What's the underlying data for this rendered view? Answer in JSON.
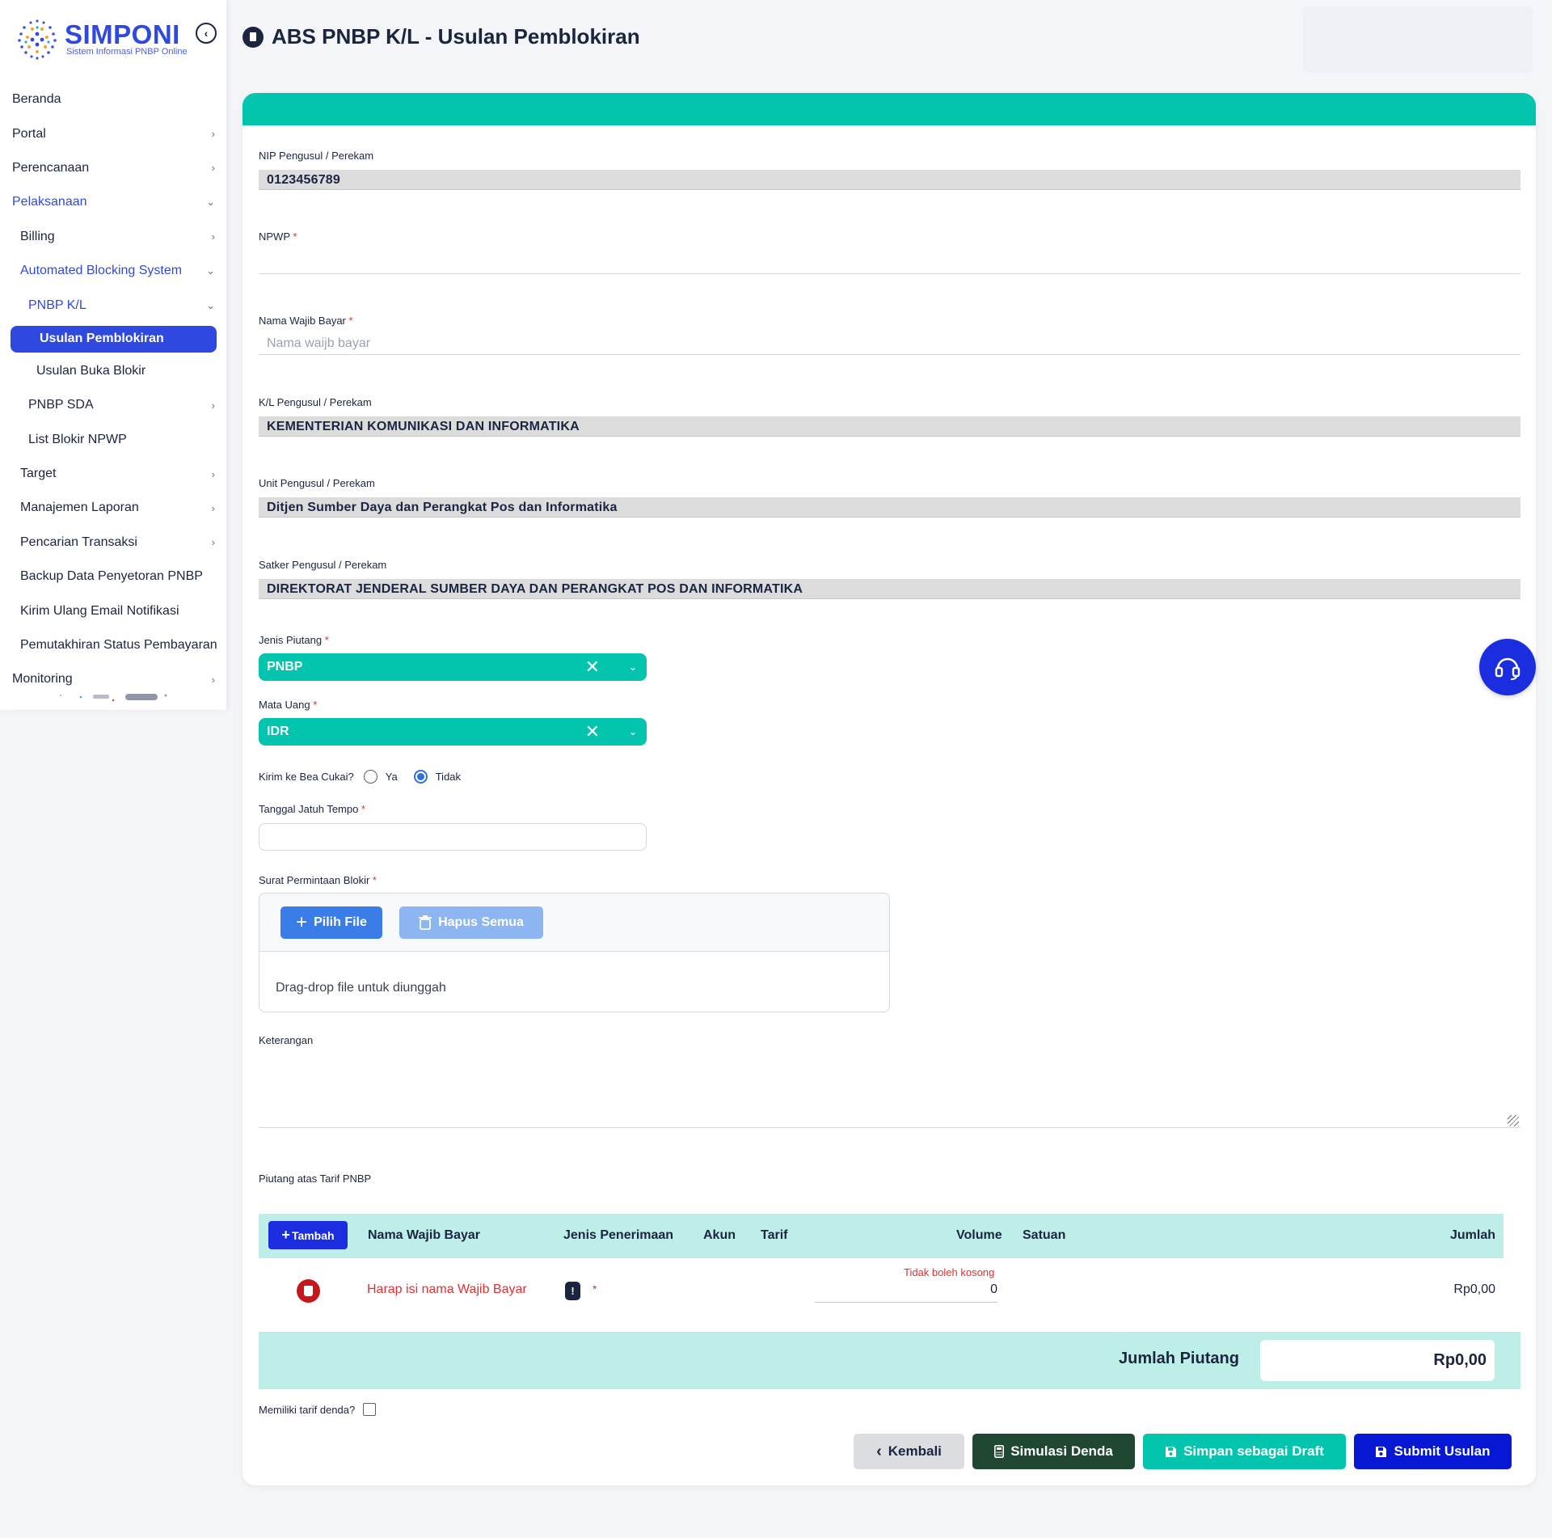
{
  "brand": {
    "name": "SIMPONI",
    "tagline": "Sistem Informasi PNBP Online"
  },
  "sidebar": {
    "items": [
      {
        "label": "Beranda",
        "level": 0
      },
      {
        "label": "Portal",
        "level": 0,
        "chevron": "right"
      },
      {
        "label": "Perencanaan",
        "level": 0,
        "chevron": "right"
      },
      {
        "label": "Pelaksanaan",
        "level": 0,
        "chevron": "down",
        "active": true
      },
      {
        "label": "Billing",
        "level": 1,
        "chevron": "right"
      },
      {
        "label": "Automated Blocking System",
        "level": 1,
        "chevron": "down",
        "active": true
      },
      {
        "label": "PNBP K/L",
        "level": 2,
        "chevron": "down",
        "active": true
      },
      {
        "label": "Usulan Pemblokiran",
        "level": 3,
        "selected": true
      },
      {
        "label": "Usulan Buka Blokir",
        "level": 3
      },
      {
        "label": "PNBP SDA",
        "level": 2,
        "chevron": "right"
      },
      {
        "label": "List Blokir NPWP",
        "level": 2
      },
      {
        "label": "Target",
        "level": 1,
        "chevron": "right"
      },
      {
        "label": "Manajemen Laporan",
        "level": 1,
        "chevron": "right"
      },
      {
        "label": "Pencarian Transaksi",
        "level": 1,
        "chevron": "right"
      },
      {
        "label": "Backup Data Penyetoran PNBP",
        "level": 1
      },
      {
        "label": "Kirim Ulang Email Notifikasi",
        "level": 1
      },
      {
        "label": "Pemutakhiran Status Pembayaran",
        "level": 1
      },
      {
        "label": "Monitoring",
        "level": 0,
        "chevron": "right"
      }
    ]
  },
  "header": {
    "title": "ABS PNBP K/L - Usulan Pemblokiran"
  },
  "form": {
    "nip": {
      "label": "NIP Pengusul / Perekam",
      "value": "0123456789"
    },
    "npwp": {
      "label": "NPWP",
      "value": ""
    },
    "nama_wajib_bayar": {
      "label": "Nama Wajib Bayar",
      "placeholder": "Nama waijb bayar"
    },
    "kl": {
      "label": "K/L Pengusul / Perekam",
      "value": "KEMENTERIAN KOMUNIKASI DAN INFORMATIKA"
    },
    "unit": {
      "label": "Unit Pengusul / Perekam",
      "value": "Ditjen Sumber Daya dan Perangkat Pos dan Informatika"
    },
    "satker": {
      "label": "Satker Pengusul / Perekam",
      "value": "DIREKTORAT JENDERAL SUMBER DAYA DAN PERANGKAT POS DAN INFORMATIKA"
    },
    "jenis_piutang": {
      "label": "Jenis Piutang",
      "value": "PNBP"
    },
    "mata_uang": {
      "label": "Mata Uang",
      "value": "IDR"
    },
    "bea_cukai": {
      "label": "Kirim ke Bea Cukai?",
      "option_yes": "Ya",
      "option_no": "Tidak",
      "selected": "Tidak"
    },
    "jatuh_tempo": {
      "label": "Tanggal Jatuh Tempo",
      "value": ""
    },
    "surat": {
      "label": "Surat Permintaan Blokir",
      "pick_label": "Pilih File",
      "clear_label": "Hapus Semua",
      "hint": "Drag-drop file untuk diunggah"
    },
    "keterangan": {
      "label": "Keterangan",
      "value": ""
    }
  },
  "piutang": {
    "section_label": "Piutang atas Tarif PNBP",
    "add_label": "Tambah",
    "columns": [
      "Nama Wajib Bayar",
      "Jenis Penerimaan",
      "Akun",
      "Tarif",
      "Volume",
      "Satuan",
      "Jumlah"
    ],
    "row": {
      "nama_warning": "Harap isi nama Wajib Bayar",
      "volume_error": "Tidak boleh kosong",
      "volume": "0",
      "jumlah": "Rp0,00"
    },
    "total_label": "Jumlah Piutang",
    "total_value": "Rp0,00"
  },
  "denda": {
    "label": "Memiliki tarif denda?",
    "checked": false
  },
  "actions": {
    "back": "Kembali",
    "simulasi": "Simulasi Denda",
    "draft": "Simpan sebagai Draft",
    "submit": "Submit Usulan"
  },
  "colors": {
    "primary": "#2f49e0",
    "teal": "#03c4ad",
    "table_head": "#bdeee8",
    "danger": "#e03131",
    "dark_green": "#1f4731",
    "submit": "#0618d4"
  },
  "icons": {
    "help": "headset-icon",
    "collapse": "chevron-left-icon",
    "page": "document-icon"
  }
}
